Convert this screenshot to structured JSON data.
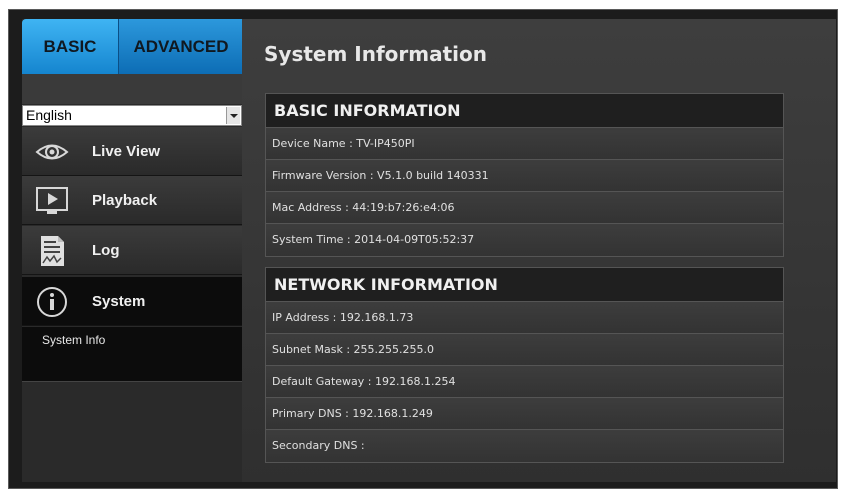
{
  "tabs": {
    "basic": "BASIC",
    "advanced": "ADVANCED"
  },
  "language": {
    "selected": "English"
  },
  "nav": [
    {
      "label": "Live View",
      "icon": "eye-icon"
    },
    {
      "label": "Playback",
      "icon": "play-monitor-icon"
    },
    {
      "label": "Log",
      "icon": "log-document-icon"
    },
    {
      "label": "System",
      "icon": "info-icon"
    }
  ],
  "subnav": {
    "system_info": "System Info"
  },
  "page": {
    "title": "System Information"
  },
  "basic_info": {
    "title": "BASIC INFORMATION",
    "rows": [
      "Device Name : TV-IP450PI",
      "Firmware Version : V5.1.0 build 140331",
      "Mac Address : 44:19:b7:26:e4:06",
      "System Time : 2014-04-09T05:52:37"
    ]
  },
  "network_info": {
    "title": "NETWORK INFORMATION",
    "rows": [
      "IP Address : 192.168.1.73",
      "Subnet Mask : 255.255.255.0",
      "Default Gateway : 192.168.1.254",
      "Primary DNS : 192.168.1.249",
      "Secondary DNS :"
    ]
  },
  "colors": {
    "accent": "#1585cf",
    "background": "#1c1c1c",
    "panel_header": "#1f1f1f"
  }
}
